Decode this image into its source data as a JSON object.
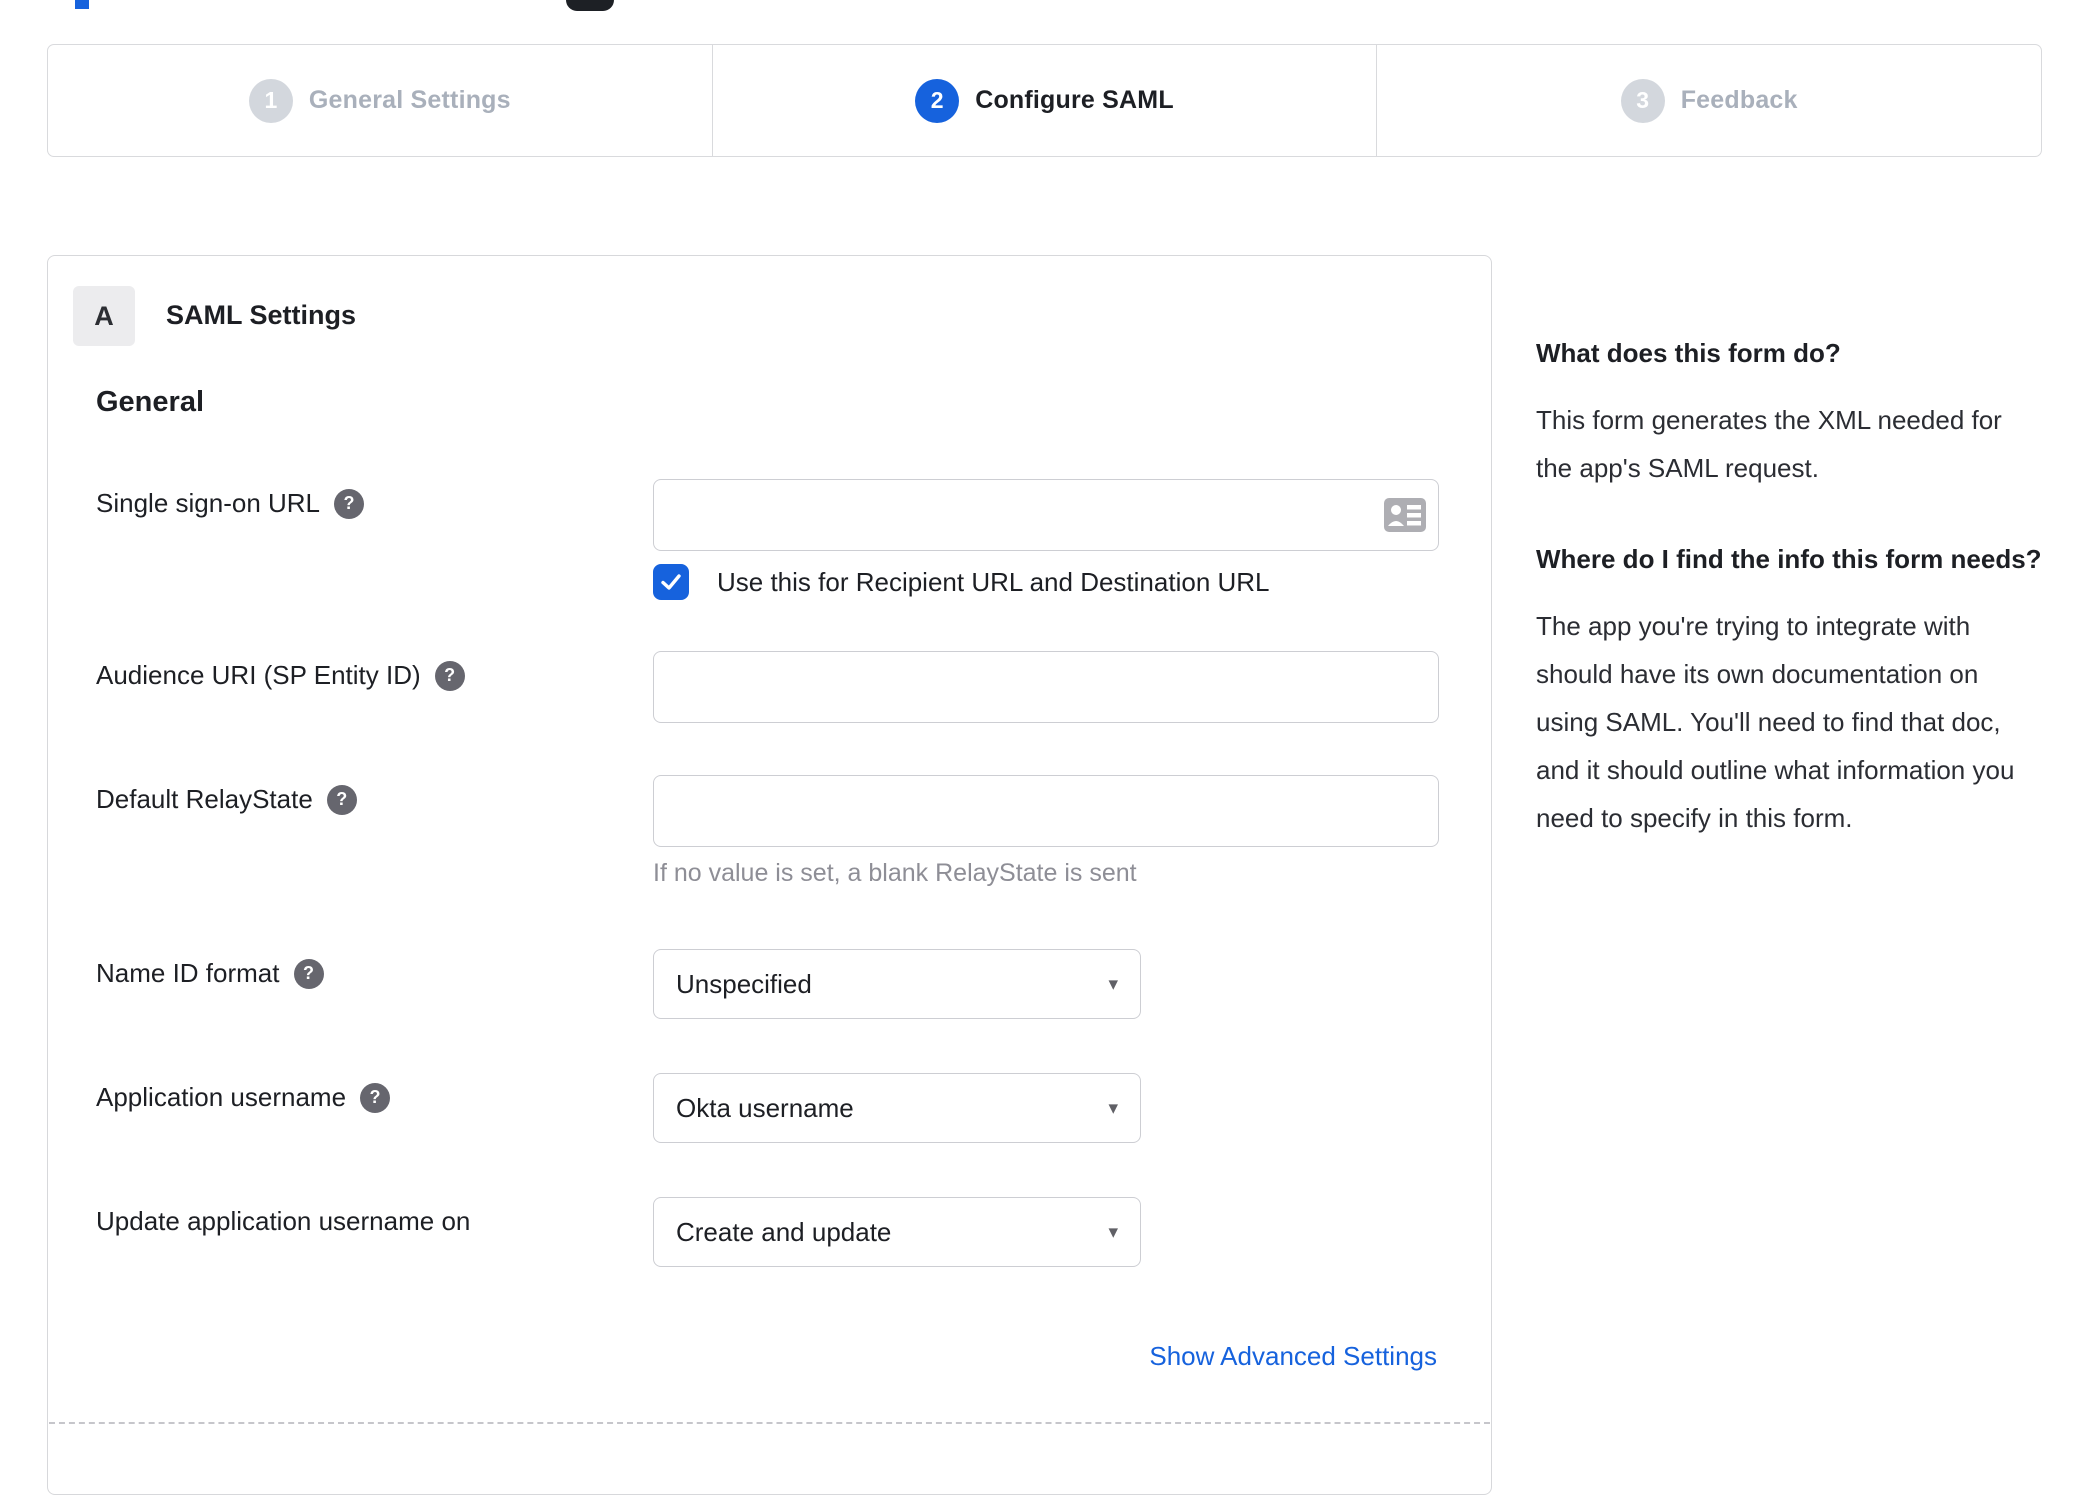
{
  "colors": {
    "accent": "#1662dd",
    "inactive_gray": "#a9b0bb"
  },
  "artifacts": {
    "note": "clipped page header elements at top edge"
  },
  "stepper": {
    "steps": [
      {
        "number": "1",
        "label": "General Settings",
        "state": "inactive"
      },
      {
        "number": "2",
        "label": "Configure SAML",
        "state": "active"
      },
      {
        "number": "3",
        "label": "Feedback",
        "state": "inactive"
      }
    ]
  },
  "panel": {
    "badge": "A",
    "title": "SAML Settings",
    "section_heading": "General",
    "rows": [
      {
        "label": "Single sign-on URL",
        "value": "",
        "checkbox": {
          "checked": true,
          "label": "Use this for Recipient URL and Destination URL"
        }
      },
      {
        "label": "Audience URI (SP Entity ID)",
        "value": ""
      },
      {
        "label": "Default RelayState",
        "value": "",
        "hint": "If no value is set, a blank RelayState is sent"
      },
      {
        "label": "Name ID format",
        "value": "Unspecified"
      },
      {
        "label": "Application username",
        "value": "Okta username"
      },
      {
        "label": "Update application username on",
        "value": "Create and update"
      }
    ],
    "advanced_link": "Show Advanced Settings"
  },
  "sidebar": {
    "sections": [
      {
        "title": "What does this form do?",
        "body": "This form generates the XML needed for the app's SAML request."
      },
      {
        "title": "Where do I find the info this form needs?",
        "body": "The app you're trying to integrate with should have its own documentation on using SAML. You'll need to find that doc, and it should outline what information you need to specify in this form."
      }
    ]
  }
}
